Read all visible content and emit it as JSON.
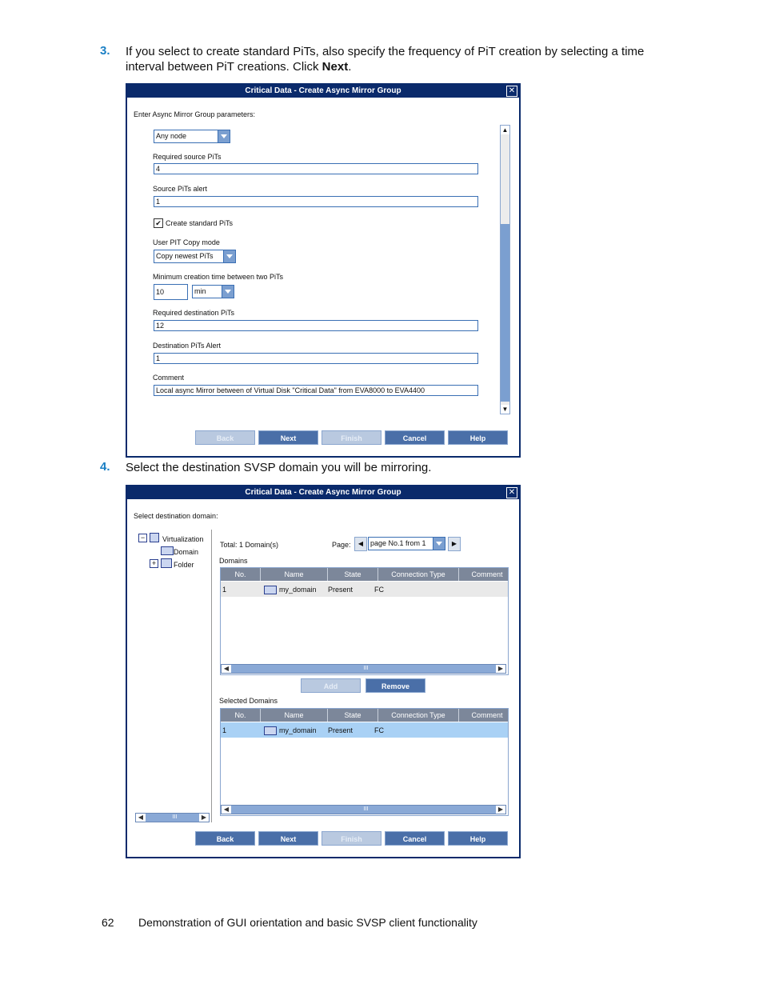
{
  "step3": {
    "number": "3.",
    "text_before": "If you select to create standard PiTs, also specify the frequency of PiT creation by selecting a time interval between PiT creations. Click ",
    "bold": "Next",
    "text_after": "."
  },
  "dialog1": {
    "title": "Critical Data - Create Async Mirror Group",
    "close_icon": "close-icon",
    "intro": "Enter Async Mirror Group parameters:",
    "node_combo": "Any node",
    "required_source_label": "Required source PiTs",
    "required_source_value": "4",
    "source_alert_label": "Source PiTs alert",
    "source_alert_value": "1",
    "create_standard_label": "Create standard PiTs",
    "create_standard_checked": true,
    "copy_mode_label": "User PIT Copy mode",
    "copy_mode_value": "Copy newest PiTs",
    "min_time_label": "Minimum creation time between two PiTs",
    "min_time_value": "10",
    "min_time_unit": "min",
    "required_dest_label": "Required destination PiTs",
    "required_dest_value": "12",
    "dest_alert_label": "Destination PiTs Alert",
    "dest_alert_value": "1",
    "comment_label": "Comment",
    "comment_value": "Local async Mirror between of Virtual Disk \"Critical Data\" from EVA8000 to EVA4400",
    "buttons": {
      "back": "Back",
      "next": "Next",
      "finish": "Finish",
      "cancel": "Cancel",
      "help": "Help"
    }
  },
  "step4": {
    "number": "4.",
    "text": "Select the destination SVSP domain you will be mirroring."
  },
  "dialog2": {
    "title": "Critical Data - Create Async Mirror Group",
    "intro": "Select destination domain:",
    "tree": {
      "root": "Virtualization",
      "child1": "Domain",
      "child2": "Folder"
    },
    "total": "Total: 1 Domain(s)",
    "page_label": "Page:",
    "page_value": "page No.1 from 1",
    "domains_label": "Domains",
    "columns": [
      "No.",
      "Name",
      "State",
      "Connection Type",
      "Comment"
    ],
    "domains_rows": [
      {
        "no": "1",
        "name": "my_domain",
        "state": "Present",
        "conn": "FC"
      }
    ],
    "add_label": "Add",
    "remove_label": "Remove",
    "selected_label": "Selected Domains",
    "selected_rows": [
      {
        "no": "1",
        "name": "my_domain",
        "state": "Present",
        "conn": "FC"
      }
    ],
    "buttons": {
      "back": "Back",
      "next": "Next",
      "finish": "Finish",
      "cancel": "Cancel",
      "help": "Help"
    }
  },
  "footer": {
    "page_number": "62",
    "text": "Demonstration of GUI orientation and basic SVSP client functionality"
  }
}
